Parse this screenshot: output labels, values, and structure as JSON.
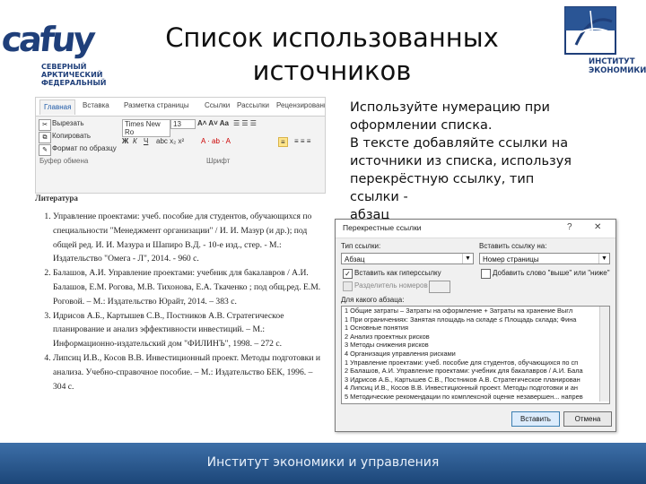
{
  "logos": {
    "left_big": "cafuy",
    "left_sub": "СЕВЕРНЫЙ АРКТИЧЕСКИЙ ФЕДЕРАЛЬНЫЙ",
    "right_text_1": "ИНСТИТУТ",
    "right_text_2": "ЭКОНОМИКИ"
  },
  "slide": {
    "title_line1": "Список использованных",
    "title_line2": "источников",
    "instructions": [
      "Используйте нумерацию при",
      "оформлении списка.",
      "В тексте добавляйте ссылки на",
      "источники из списка, используя",
      "перекрёстную ссылку, тип ссылки -",
      "абзац"
    ],
    "footer": "Институт экономики и управления"
  },
  "ribbon": {
    "tabs": [
      "Главная",
      "Вставка",
      "Разметка страницы",
      "Ссылки",
      "Рассылки",
      "Рецензирование"
    ],
    "cut": "Вырезать",
    "copy": "Копировать",
    "format": "Формат по образцу",
    "clipboard_group": "Буфер обмена",
    "font_name": "Times New Ro",
    "font_size": "13",
    "font_group": "Шрифт"
  },
  "document": {
    "heading": "Литература",
    "references": [
      "Управление проектами: учеб. пособие для студентов, обучающихся по специальности \"Менеджмент организации\" / И. И. Мазур (и др.); под общей ред. И. И. Мазура и Шапиро В.Д. - 10-е изд., стер. - М.: Издательство \"Омега - Л\", 2014. - 960 с.",
      "Балашов, А.И. Управление проектами: учебник для бакалавров / А.И. Балашов, Е.М. Рогова, М.В. Тихонова, Е.А. Ткаченко ; под общ.ред. Е.М. Роговой. – М.: Издательство Юрайт, 2014. – 383 с.",
      "Идрисов А.Б., Картышев С.В., Постников А.В. Стратегическое планирование и анализ эффективности инвестиций. – М.: Информационно-издательский дом \"ФИЛИНЪ\", 1998. – 272 с.",
      "Липсиц И.В., Косов В.В. Инвестиционный проект. Методы подготовки и анализа. Учебно-справочное пособие. – М.: Издательство БЕК, 1996. – 304 с."
    ]
  },
  "dialog": {
    "title": "Перекрестные ссылки",
    "help": "?",
    "close": "✕",
    "ref_type_label": "Тип ссылки:",
    "ref_type_value": "Абзац",
    "insert_label": "Вставить ссылку на:",
    "insert_value": "Номер страницы",
    "hyperlink_label": "Вставить как гиперссылку",
    "hyperlink_checked": true,
    "above_below_label": "Добавить слово \"выше\" или \"ниже\"",
    "above_below_checked": false,
    "separate_label": "Разделитель номеров",
    "which_label": "Для какого абзаца:",
    "list_items": [
      "1 Общие затраты – Затраты на оформление + Затраты на хранение Выгл",
      "1 При ограничениях: Занятая площадь на складе ≤ Площадь склада; Фина",
      "1 Основные понятия",
      "2 Анализ проектных рисков",
      "3 Методы снижения рисков",
      "4 Организация управления рисками",
      "1 Управление проектами: учеб. пособие для студентов, обучающихся по сп",
      "2 Балашов, А.И. Управление проектами: учебник для бакалавров / А.И. Бала",
      "3 Идрисов А.Б., Картышев С.В., Постников А.В. Стратегическое планирован",
      "4 Липсиц И.В., Косов В.В. Инвестиционный проект. Методы подготовки и ан",
      "5 Методические рекомендации по комплексной оценке незавершен... напрев"
    ],
    "insert_button": "Вставить",
    "cancel_button": "Отмена"
  },
  "colors": {
    "brand_blue": "#1f3f7a",
    "footer_top": "#3d6fa8",
    "footer_bottom": "#1c4678"
  }
}
